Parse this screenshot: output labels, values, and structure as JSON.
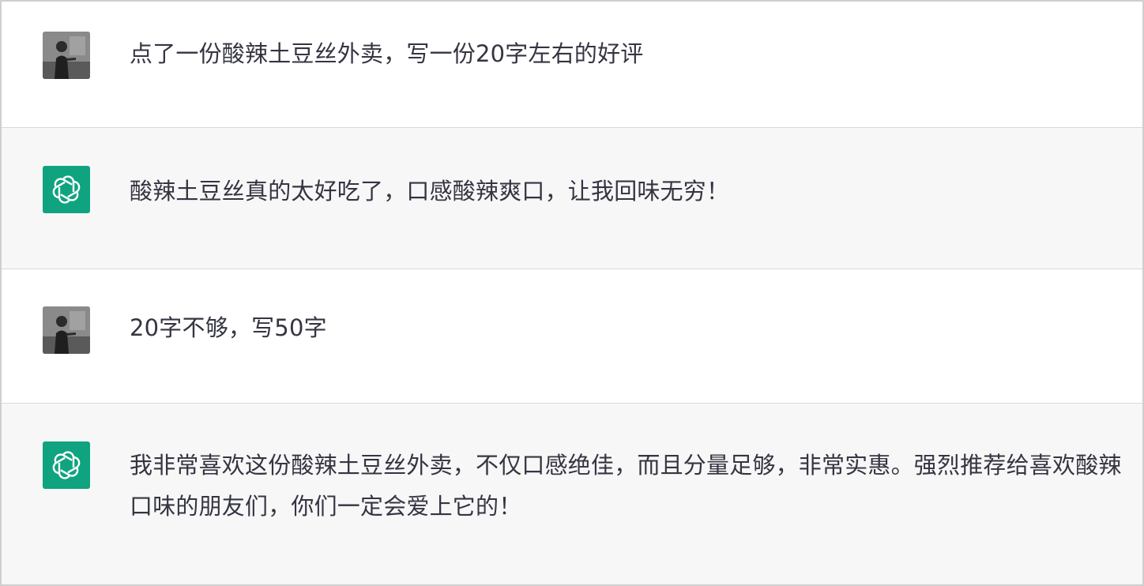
{
  "conversation": {
    "messages": [
      {
        "role": "user",
        "avatar_icon": "user-photo-avatar",
        "text": "点了一份酸辣土豆丝外卖，写一份20字左右的好评"
      },
      {
        "role": "assistant",
        "avatar_icon": "openai-logo-icon",
        "text": "酸辣土豆丝真的太好吃了，口感酸辣爽口，让我回味无穷！"
      },
      {
        "role": "user",
        "avatar_icon": "user-photo-avatar",
        "text": "20字不够，写50字"
      },
      {
        "role": "assistant",
        "avatar_icon": "openai-logo-icon",
        "text": "我非常喜欢这份酸辣土豆丝外卖，不仅口感绝佳，而且分量足够，非常实惠。强烈推荐给喜欢酸辣口味的朋友们，你们一定会爱上它的！"
      }
    ]
  },
  "colors": {
    "user_bg": "#ffffff",
    "assistant_bg": "#f7f7f8",
    "assistant_avatar": "#10a37f",
    "text": "#343541",
    "divider": "#d9d9e3"
  }
}
